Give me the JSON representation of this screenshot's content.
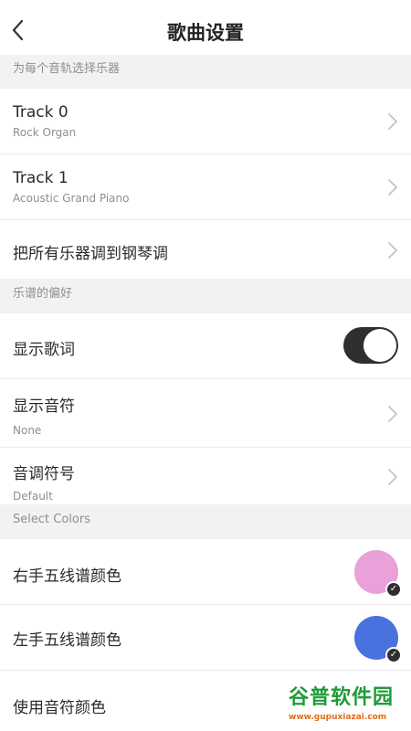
{
  "header": {
    "title": "歌曲设置"
  },
  "sections": {
    "instruments": "为每个音轨选择乐器",
    "preferences": "乐谱的偏好",
    "colors": "Select Colors"
  },
  "tracks": [
    {
      "label": "Track 0",
      "instrument": "Rock Organ"
    },
    {
      "label": "Track 1",
      "instrument": "Acoustic Grand Piano"
    }
  ],
  "all_piano": {
    "label": "把所有乐器调到钢琴调"
  },
  "show_lyrics": {
    "label": "显示歌词",
    "enabled": true
  },
  "show_notes": {
    "label": "显示音符",
    "value": "None"
  },
  "key_signature": {
    "label": "音调符号",
    "value": "Default"
  },
  "right_hand": {
    "label": "右手五线谱颜色",
    "color": "#eaa0d8"
  },
  "left_hand": {
    "label": "左手五线谱颜色",
    "color": "#4a72de"
  },
  "note_colors": {
    "label": "使用音符颜色"
  },
  "watermark": {
    "brand": "谷普软件园",
    "url": "www.gupuxiazai.com"
  }
}
